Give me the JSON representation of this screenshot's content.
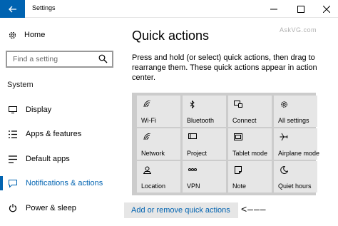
{
  "window": {
    "title": "Settings",
    "watermark": "AskVG.com"
  },
  "sidebar": {
    "home_label": "Home",
    "search_placeholder": "Find a setting",
    "section_label": "System",
    "items": [
      {
        "label": "Display",
        "icon": "display-icon",
        "active": false
      },
      {
        "label": "Apps & features",
        "icon": "apps-list-icon",
        "active": false
      },
      {
        "label": "Default apps",
        "icon": "default-apps-icon",
        "active": false
      },
      {
        "label": "Notifications & actions",
        "icon": "notifications-icon",
        "active": true
      },
      {
        "label": "Power & sleep",
        "icon": "power-icon",
        "active": false
      }
    ]
  },
  "main": {
    "title": "Quick actions",
    "description": "Press and hold (or select) quick actions, then drag to rearrange them. These quick actions appear in action center.",
    "tiles": [
      {
        "label": "Wi-Fi",
        "icon": "wifi-icon"
      },
      {
        "label": "Bluetooth",
        "icon": "bluetooth-icon"
      },
      {
        "label": "Connect",
        "icon": "connect-icon"
      },
      {
        "label": "All settings",
        "icon": "gear-icon"
      },
      {
        "label": "Network",
        "icon": "network-icon"
      },
      {
        "label": "Project",
        "icon": "project-icon"
      },
      {
        "label": "Tablet mode",
        "icon": "tablet-mode-icon"
      },
      {
        "label": "Airplane mode",
        "icon": "airplane-icon"
      },
      {
        "label": "Location",
        "icon": "location-icon"
      },
      {
        "label": "VPN",
        "icon": "vpn-icon"
      },
      {
        "label": "Note",
        "icon": "note-icon"
      },
      {
        "label": "Quiet hours",
        "icon": "moon-icon"
      }
    ],
    "add_remove_label": "Add or remove quick actions",
    "arrow_annotation": "<–––"
  },
  "colors": {
    "accent": "#0063b1",
    "tile_bg": "#e6e6e6",
    "panel_bg": "#cccccc"
  }
}
